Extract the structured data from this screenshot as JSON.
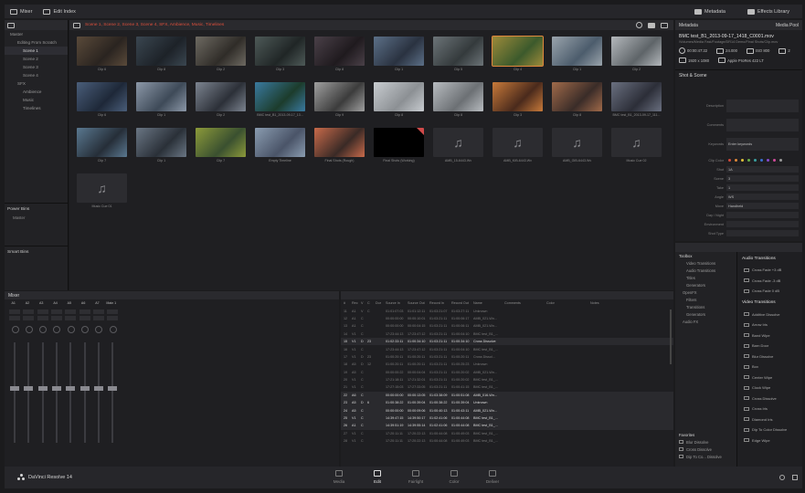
{
  "topbar": {
    "mixer_label": "Mixer",
    "edit_index_label": "Edit Index",
    "metadata_label": "Metadata",
    "effects_library_label": "Effects Library"
  },
  "bins": {
    "items": [
      {
        "label": "Master",
        "level": 0
      },
      {
        "label": "Editing From Scratch",
        "level": 1
      },
      {
        "label": "Scene 1",
        "level": 2,
        "selected": true
      },
      {
        "label": "Scene 2",
        "level": 2
      },
      {
        "label": "Scene 3",
        "level": 2
      },
      {
        "label": "Scene 4",
        "level": 2
      },
      {
        "label": "SFX",
        "level": 1
      },
      {
        "label": "Ambience",
        "level": 2
      },
      {
        "label": "Music",
        "level": 2
      },
      {
        "label": "Timelines",
        "level": 2
      }
    ],
    "power_bins_label": "Power Bins",
    "power_bins_item": "Master",
    "smart_bins_label": "Smart Bins"
  },
  "pool": {
    "path": "Scene 1, Scene 2, Scene 3, Scene 4, SFX, Ambience, Music, Timelines",
    "clips": [
      {
        "label": "Clip 6",
        "kind": "video",
        "c1": "#5a4a3a",
        "c2": "#2a2420"
      },
      {
        "label": "Clip 8",
        "kind": "video",
        "c1": "#3a4650",
        "c2": "#1d2228"
      },
      {
        "label": "Clip 2",
        "kind": "video",
        "c1": "#6e6a62",
        "c2": "#2f2c28"
      },
      {
        "label": "Clip 3",
        "kind": "video",
        "c1": "#4e5a58",
        "c2": "#202626"
      },
      {
        "label": "Clip 8",
        "kind": "video",
        "c1": "#4a4048",
        "c2": "#1f1a1e"
      },
      {
        "label": "Clip 1",
        "kind": "video",
        "c1": "#5c7088",
        "c2": "#2a3240"
      },
      {
        "label": "Clip 5",
        "kind": "video",
        "c1": "#6c7478",
        "c2": "#343a3c"
      },
      {
        "label": "Clip 4",
        "kind": "video",
        "c1": "#9c8a3a",
        "c2": "#3c5a2c",
        "selected": true
      },
      {
        "label": "Clip 1",
        "kind": "video",
        "c1": "#9aa4ac",
        "c2": "#4c5c6c"
      },
      {
        "label": "Clip 2",
        "kind": "video",
        "c1": "#b4b8bc",
        "c2": "#5e6468"
      },
      {
        "label": "Clip 6",
        "kind": "video",
        "c1": "#4a5e7a",
        "c2": "#1e2838"
      },
      {
        "label": "Clip 1",
        "kind": "video",
        "c1": "#8c98a8",
        "c2": "#3e4a58"
      },
      {
        "label": "Clip 2",
        "kind": "video",
        "c1": "#7c8490",
        "c2": "#2c3038"
      },
      {
        "label": "BMC test_B1_2013-09-17_13...",
        "kind": "video",
        "c1": "#3a7aa0",
        "c2": "#1c3c2c"
      },
      {
        "label": "Clip 9",
        "kind": "video",
        "c1": "#a0a0a0",
        "c2": "#3c3c3c"
      },
      {
        "label": "Clip 8",
        "kind": "video",
        "c1": "#c8ccd0",
        "c2": "#8c9094"
      },
      {
        "label": "Clip 8",
        "kind": "video",
        "c1": "#b8bcc0",
        "c2": "#6c7074"
      },
      {
        "label": "Clip 3",
        "kind": "video",
        "c1": "#c87a3a",
        "c2": "#4a2a1c"
      },
      {
        "label": "Clip 8",
        "kind": "video",
        "c1": "#a06a4a",
        "c2": "#3a2c28"
      },
      {
        "label": "BMC test_B1_2013-09-17_111...",
        "kind": "video",
        "c1": "#6a7080",
        "c2": "#2c2e38"
      },
      {
        "label": "Clip 7",
        "kind": "video",
        "c1": "#5a7890",
        "c2": "#262e38"
      },
      {
        "label": "Clip 1",
        "kind": "video",
        "c1": "#6a7684",
        "c2": "#2a3038"
      },
      {
        "label": "Clip 7",
        "kind": "video",
        "c1": "#8c9a3a",
        "c2": "#3a5030"
      },
      {
        "label": "Empty Timeline",
        "kind": "video",
        "c1": "#8a9cb0",
        "c2": "#4a5468"
      },
      {
        "label": "Final Shots (Rough)",
        "kind": "video",
        "c1": "#c86a4a",
        "c2": "#3a2a26"
      },
      {
        "label": "Final Shots (Working)",
        "kind": "dark",
        "c1": "#000000",
        "c2": "#000000"
      },
      {
        "label": "AMB_15-6443.Wv",
        "kind": "audio"
      },
      {
        "label": "AMB_KIB-6443.Wv",
        "kind": "audio"
      },
      {
        "label": "AMB_GIB-6443.Wv",
        "kind": "audio"
      },
      {
        "label": "Music Cue 02",
        "kind": "audio"
      },
      {
        "label": "Music Cue 01",
        "kind": "audio"
      }
    ]
  },
  "meta": {
    "title": "Metadata",
    "media_pool": "Media Pool",
    "filename": "BMC test_B1_2013-09-17_1418_C0001.mov",
    "filepath": "/Volumes/Media Fast/Footage/DR14 Demo/Final Shots/Clip.mov",
    "props": {
      "tc": "00:00:47:22",
      "fps": "24.000",
      "iso": "ISO 800",
      "ch": "2",
      "res": "1920 x 1080",
      "codec": "Apple ProRes 422 LT"
    },
    "shot_scene": "Shot & Scene",
    "fields": [
      {
        "label": "Description",
        "value": ""
      },
      {
        "label": "Comments",
        "value": ""
      },
      {
        "label": "Keywords",
        "value": "Enter keywords"
      },
      {
        "label": "Clip Color",
        "value": ""
      },
      {
        "label": "Shot",
        "value": "1A"
      },
      {
        "label": "Scene",
        "value": "3"
      },
      {
        "label": "Take",
        "value": "1"
      },
      {
        "label": "Angle",
        "value": "WS"
      },
      {
        "label": "Move",
        "value": "Handheld"
      },
      {
        "label": "Day / Night",
        "value": ""
      },
      {
        "label": "Environment",
        "value": ""
      },
      {
        "label": "Shot Type",
        "value": ""
      }
    ],
    "colors": [
      "#d24a3a",
      "#e08a3a",
      "#e0c03a",
      "#6ab04a",
      "#3aa0a0",
      "#3a70d0",
      "#8a4ad0",
      "#d04a9a",
      "#9a9a9a"
    ]
  },
  "fx": {
    "tree": [
      {
        "label": "Toolbox",
        "type": "hd"
      },
      {
        "label": "Video Transitions",
        "type": "i1"
      },
      {
        "label": "Audio Transitions",
        "type": "i1"
      },
      {
        "label": "Titles",
        "type": "i1"
      },
      {
        "label": "Generators",
        "type": "i1"
      },
      {
        "label": "OpenFX",
        "type": "i2"
      },
      {
        "label": "Filters",
        "type": "i1"
      },
      {
        "label": "Transitions",
        "type": "i1"
      },
      {
        "label": "Generators",
        "type": "i1"
      },
      {
        "label": "Audio FX",
        "type": "i2"
      }
    ],
    "favorites_label": "Favorites",
    "favorites": [
      "Blur Dissolve",
      "Cross Dissolve",
      "Dip To Co... Dissolve"
    ],
    "audio_transitions_title": "Audio Transitions",
    "audio_transitions": [
      "Cross Fade +3 dB",
      "Cross Fade -3 dB",
      "Cross Fade 0 dB"
    ],
    "video_transitions_title": "Video Transitions",
    "video_transitions": [
      "Additive Dissolve",
      "Arrow Iris",
      "Band Wipe",
      "Barn Door",
      "Blur Dissolve",
      "Box",
      "Center Wipe",
      "Clock Wipe",
      "Cross Dissolve",
      "Cross Iris",
      "Diamond Iris",
      "Dip To Color Dissolve",
      "Edge Wipe"
    ]
  },
  "mixer": {
    "title": "Mixer",
    "channels": [
      "A1",
      "A2",
      "A3",
      "A4",
      "A5",
      "A6",
      "A7",
      "Main 1"
    ]
  },
  "index": {
    "columns": [
      "#",
      "Rec",
      "V",
      "C",
      "Dur",
      "Source In",
      "Source Out",
      "Record In",
      "Record Out",
      "Name",
      "Comments",
      "Color",
      "Notes"
    ],
    "rows": [
      [
        "11",
        "A1",
        "V",
        "C",
        "",
        "01:01:07:03",
        "01:01:12:11",
        "01:03:21:07",
        "01:03:27:11",
        "Unknown",
        false
      ],
      [
        "12",
        "A1",
        "C",
        "",
        "",
        "00:00:00:00",
        "00:00:10:01",
        "01:03:21:11",
        "01:00:06:17",
        "AMB_021-Wn...",
        false
      ],
      [
        "13",
        "A1",
        "C",
        "",
        "",
        "00:00:00:00",
        "00:00:04:15",
        "01:03:21:11",
        "01:00:06:11",
        "AMB_021-Wn...",
        false
      ],
      [
        "14",
        "V1",
        "C",
        "",
        "",
        "17:23:44:13",
        "17:23:47:12",
        "01:03:21:11",
        "01:00:04:10",
        "BMC test_B1_...",
        false
      ],
      [
        "15",
        "V1",
        "D",
        "23",
        "",
        "01:02:33:11",
        "01:00:34:10",
        "01:03:21:11",
        "01:00:34:10",
        "Cross Dissolve",
        true
      ],
      [
        "16",
        "V1",
        "C",
        "",
        "",
        "17:23:44:13",
        "17:23:47:12",
        "01:03:21:11",
        "01:00:04:10",
        "BMC test_B1_...",
        false
      ],
      [
        "17",
        "V1",
        "D",
        "23",
        "",
        "01:00:20:11",
        "01:00:20:11",
        "01:03:21:11",
        "01:00:20:11",
        "Cross Dissol...",
        false
      ],
      [
        "18",
        "A5",
        "D",
        "12",
        "",
        "01:00:20:11",
        "01:00:20:11",
        "01:03:21:11",
        "01:00:25:23",
        "Unknown",
        false
      ],
      [
        "19",
        "A5",
        "C",
        "",
        "",
        "00:00:00:22",
        "00:00:04:04",
        "01:03:21:11",
        "01:00:20:02",
        "AMB_021-Wn...",
        false
      ],
      [
        "20",
        "V1",
        "C",
        "",
        "",
        "17:21:18:11",
        "17:21:32:01",
        "01:03:21:11",
        "01:00:20:02",
        "BMC test_B1_...",
        false
      ],
      [
        "21",
        "V1",
        "C",
        "",
        "",
        "17:27:15:03",
        "17:27:33:05",
        "01:03:21:11",
        "01:00:41:15",
        "BMC test_B1_...",
        false
      ],
      [
        "22",
        "A6",
        "C",
        "",
        "",
        "00:00:00:00",
        "00:00:13:05",
        "01:03:38:09",
        "01:00:51:08",
        "AMB_016-Wn...",
        true
      ],
      [
        "23",
        "A5",
        "D",
        "6",
        "",
        "01:00:38:22",
        "01:00:39:04",
        "01:00:38:22",
        "01:00:39:04",
        "Unknown",
        true
      ],
      [
        "24",
        "A5",
        "C",
        "",
        "",
        "00:00:00:00",
        "00:00:09:06",
        "01:00:40:13",
        "01:00:43:11",
        "AMB_021-Wn...",
        true
      ],
      [
        "25",
        "V1",
        "C",
        "",
        "",
        "14:39:47:15",
        "14:39:50:17",
        "01:02:41:06",
        "01:00:44:08",
        "BMC test_B1_...",
        true
      ],
      [
        "26",
        "A1",
        "C",
        "",
        "",
        "14:39:51:19",
        "14:39:55:14",
        "01:02:41:06",
        "01:00:44:08",
        "BMC test_B1_...",
        true
      ],
      [
        "27",
        "V1",
        "C",
        "",
        "",
        "17:20:11:11",
        "17:20:22:13",
        "01:00:44:08",
        "01:00:49:03",
        "BMC test_B1_...",
        false
      ],
      [
        "28",
        "V1",
        "C",
        "",
        "",
        "17:20:11:11",
        "17:20:22:13",
        "01:00:44:08",
        "01:00:49:03",
        "BMC test_B1_...",
        false
      ]
    ]
  },
  "bottom": {
    "app_name": "DaVinci Resolve 14",
    "pages": [
      {
        "label": "Media",
        "active": false
      },
      {
        "label": "Edit",
        "active": true
      },
      {
        "label": "Fairlight",
        "active": false
      },
      {
        "label": "Color",
        "active": false
      },
      {
        "label": "Deliver",
        "active": false
      }
    ]
  }
}
